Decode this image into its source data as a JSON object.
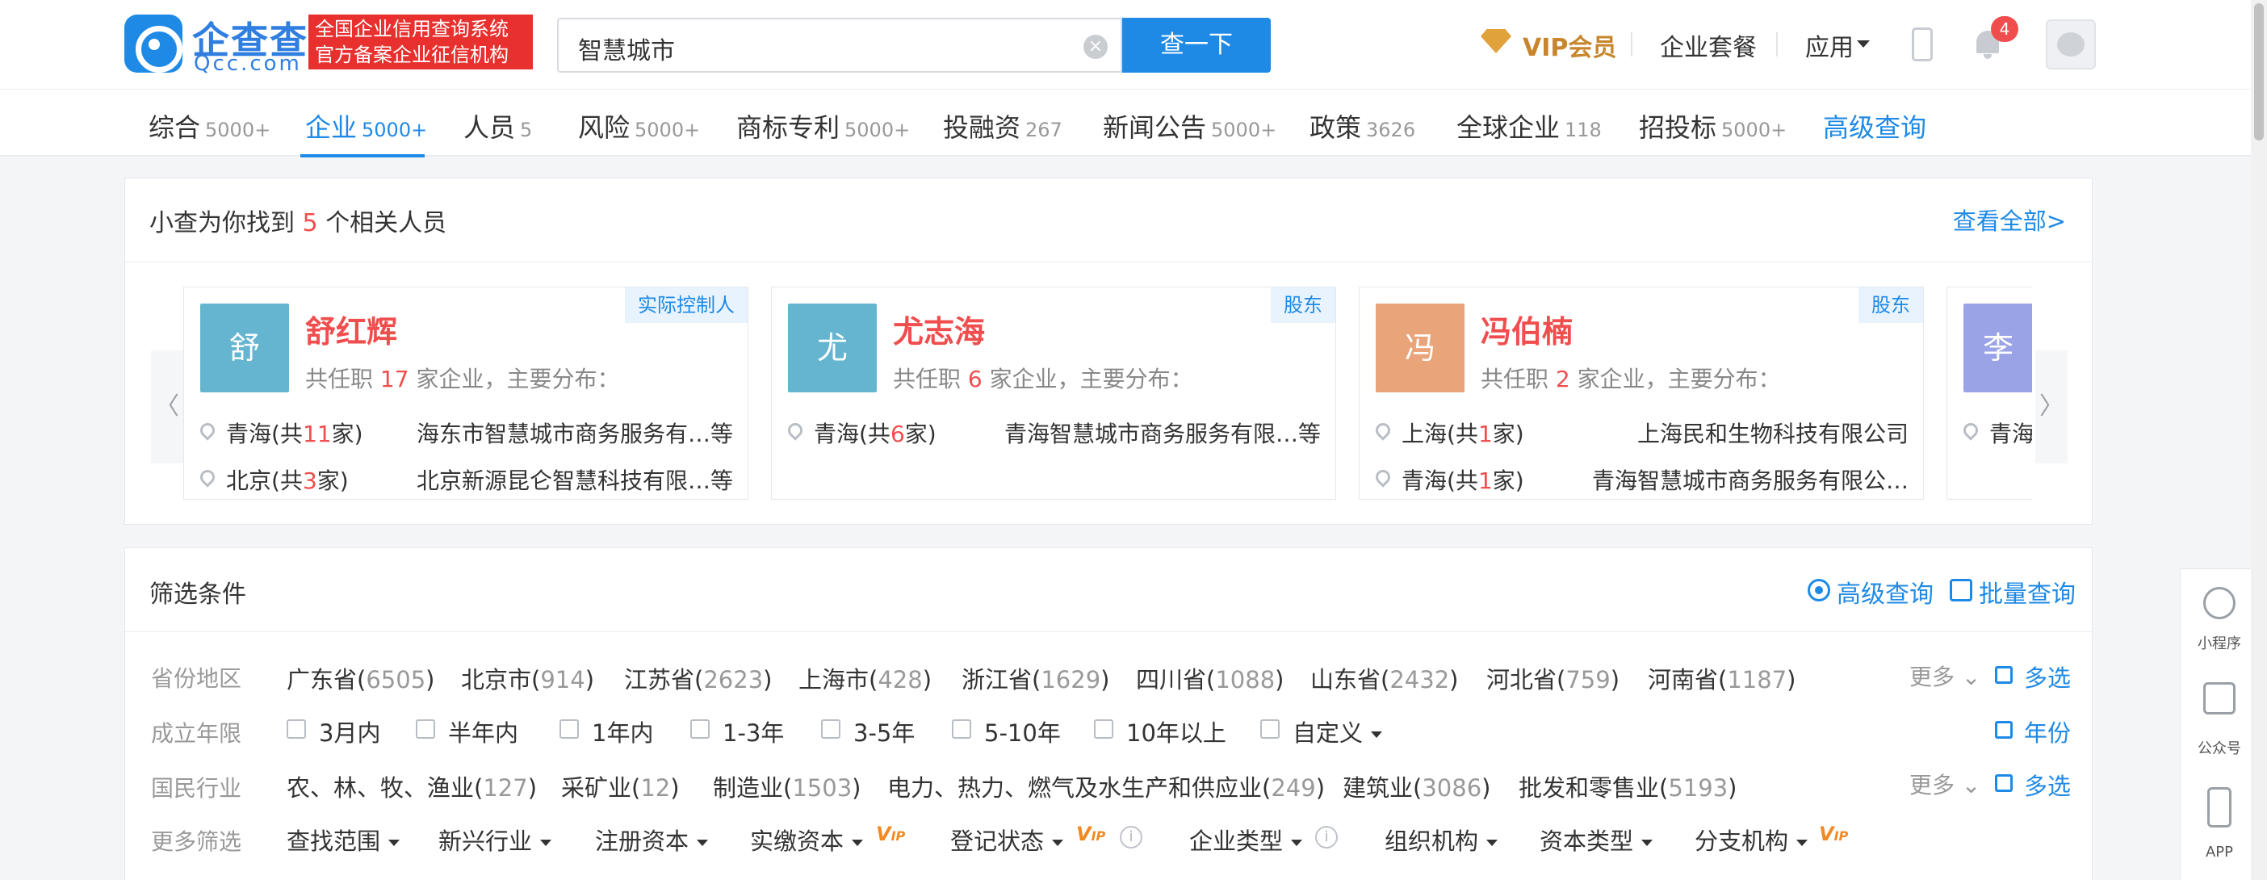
{
  "header": {
    "logo_name": "企查查",
    "logo_sub": "Qcc.com",
    "logo_tag_line1": "全国企业信用查询系统",
    "logo_tag_line2": "官方备案企业征信机构",
    "search_value": "智慧城市",
    "search_button": "查一下",
    "vip_label": "VIP会员",
    "package_label": "企业套餐",
    "app_label": "应用",
    "notification_count": "4",
    "accent_color": "#1f8ae6"
  },
  "tabs": [
    {
      "label": "综合",
      "count": "5000+"
    },
    {
      "label": "企业",
      "count": "5000+",
      "active": true
    },
    {
      "label": "人员",
      "count": "5"
    },
    {
      "label": "风险",
      "count": "5000+"
    },
    {
      "label": "商标专利",
      "count": "5000+"
    },
    {
      "label": "投融资",
      "count": "267"
    },
    {
      "label": "新闻公告",
      "count": "5000+"
    },
    {
      "label": "政策",
      "count": "3626"
    },
    {
      "label": "全球企业",
      "count": "118"
    },
    {
      "label": "招投标",
      "count": "5000+"
    },
    {
      "label": "高级查询",
      "count": ""
    }
  ],
  "persons": {
    "title_prefix": "小查为你找到",
    "title_count": "5",
    "title_suffix": "个相关人员",
    "view_all": "查看全部>",
    "prev_arrow": "〈",
    "next_arrow": "〉",
    "cards": [
      {
        "avatar_char": "舒",
        "avatar_color": "#65b5d1",
        "name": "舒红辉",
        "role": "实际控制人",
        "desc_prefix": "共任职",
        "desc_count": "17",
        "desc_suffix": "家企业，主要分布：",
        "rows": [
          {
            "region_prefix": "青海(共",
            "region_count": "11",
            "region_suffix": "家)",
            "company": "海东市智慧城市商务服务有…等"
          },
          {
            "region_prefix": "北京(共",
            "region_count": "3",
            "region_suffix": "家)",
            "company": "北京新源昆仑智慧科技有限…等"
          }
        ]
      },
      {
        "avatar_char": "尤",
        "avatar_color": "#65b5d1",
        "name": "尤志海",
        "role": "股东",
        "desc_prefix": "共任职",
        "desc_count": "6",
        "desc_suffix": "家企业，主要分布：",
        "rows": [
          {
            "region_prefix": "青海(共",
            "region_count": "6",
            "region_suffix": "家)",
            "company": "青海智慧城市商务服务有限…等"
          }
        ]
      },
      {
        "avatar_char": "冯",
        "avatar_color": "#e9a47a",
        "name": "冯伯楠",
        "role": "股东",
        "desc_prefix": "共任职",
        "desc_count": "2",
        "desc_suffix": "家企业，主要分布：",
        "rows": [
          {
            "region_prefix": "上海(共",
            "region_count": "1",
            "region_suffix": "家)",
            "company": "上海民和生物科技有限公司"
          },
          {
            "region_prefix": "青海(共",
            "region_count": "1",
            "region_suffix": "家)",
            "company": "青海智慧城市商务服务有限公…"
          }
        ]
      },
      {
        "avatar_char": "李",
        "avatar_color": "#9aa3e6",
        "region_partial": "青海"
      }
    ]
  },
  "filters": {
    "title": "筛选条件",
    "advanced": "高级查询",
    "batch": "批量查询",
    "province": {
      "label": "省份地区",
      "items": [
        {
          "name": "广东省",
          "count": "6505"
        },
        {
          "name": "北京市",
          "count": "914"
        },
        {
          "name": "江苏省",
          "count": "2623"
        },
        {
          "name": "上海市",
          "count": "428"
        },
        {
          "name": "浙江省",
          "count": "1629"
        },
        {
          "name": "四川省",
          "count": "1088"
        },
        {
          "name": "山东省",
          "count": "2432"
        },
        {
          "name": "河北省",
          "count": "759"
        },
        {
          "name": "河南省",
          "count": "1187"
        }
      ],
      "more": "更多",
      "multi": "多选"
    },
    "founded": {
      "label": "成立年限",
      "items": [
        "3月内",
        "半年内",
        "1年内",
        "1-3年",
        "3-5年",
        "5-10年",
        "10年以上",
        "自定义"
      ],
      "year_link": "年份"
    },
    "industry": {
      "label": "国民行业",
      "items": [
        {
          "name": "农、林、牧、渔业",
          "count": "127"
        },
        {
          "name": "采矿业",
          "count": "12"
        },
        {
          "name": "制造业",
          "count": "1503"
        },
        {
          "name": "电力、热力、燃气及水生产和供应业",
          "count": "249"
        },
        {
          "name": "建筑业",
          "count": "3086"
        },
        {
          "name": "批发和零售业",
          "count": "5193"
        }
      ],
      "more": "更多",
      "multi": "多选"
    },
    "more_filters": {
      "label": "更多筛选",
      "items": [
        "查找范围",
        "新兴行业",
        "注册资本",
        "实缴资本",
        "登记状态",
        "企业类型",
        "组织机构",
        "资本类型",
        "分支机构"
      ]
    }
  },
  "right_float": {
    "items": [
      "小程序",
      "公众号",
      "APP"
    ]
  }
}
